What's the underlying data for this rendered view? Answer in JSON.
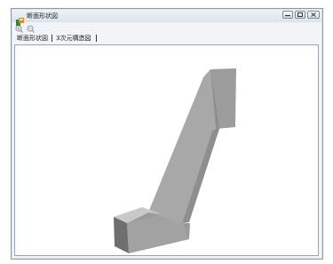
{
  "window": {
    "title": "断面形状図"
  },
  "toolbar": {
    "zoom_in_icon": "magnifier-plus-icon",
    "zoom_out_icon": "magnifier-minus-icon"
  },
  "tabs": [
    {
      "label": "断面形状図"
    },
    {
      "label": "3次元構造図"
    }
  ],
  "view": {
    "object": "3d-structure-model",
    "colors": {
      "face_light": "#c2c2c2",
      "face_mid": "#a4a4a4",
      "face_dark": "#8a8a8a",
      "face_shadow": "#6f6f6f"
    }
  }
}
